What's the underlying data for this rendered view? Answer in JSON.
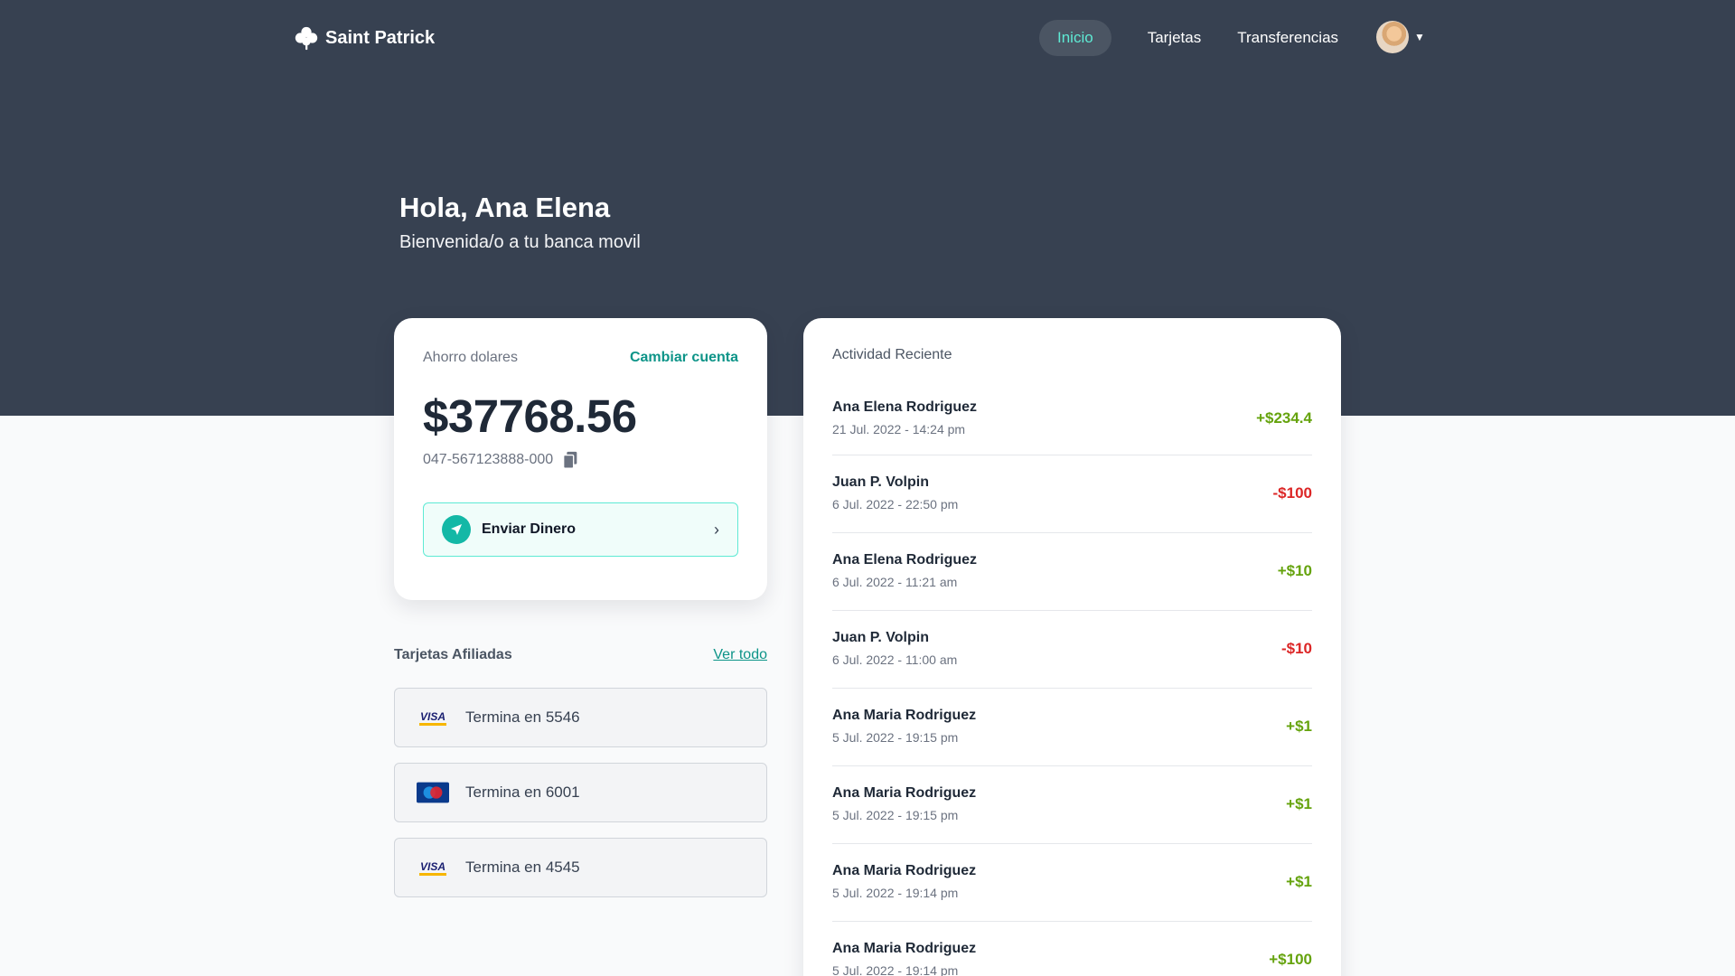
{
  "brand": {
    "name": "Saint Patrick",
    "accent": "#14b8a6",
    "nav_bg": "#374151"
  },
  "nav": {
    "items": [
      {
        "label": "Inicio",
        "active": true
      },
      {
        "label": "Tarjetas",
        "active": false
      },
      {
        "label": "Transferencias",
        "active": false
      }
    ]
  },
  "greeting": {
    "title": "Hola, Ana Elena",
    "subtitle": "Bienvenida/o a tu banca movil"
  },
  "account": {
    "type": "Ahorro dolares",
    "switch_label": "Cambiar cuenta",
    "balance": "$37768.56",
    "number": "047-567123888-000",
    "send_label": "Enviar Dinero"
  },
  "cards": {
    "title": "Tarjetas Afiliadas",
    "view_all": "Ver todo",
    "items": [
      {
        "brand": "visa-icon",
        "label": "Termina en 5546"
      },
      {
        "brand": "maestro-icon",
        "label": "Termina en 6001"
      },
      {
        "brand": "visa-icon",
        "label": "Termina en 4545"
      }
    ]
  },
  "activity": {
    "title": "Actividad Reciente",
    "items": [
      {
        "name": "Ana Elena Rodriguez",
        "date": "21 Jul. 2022 - 14:24 pm",
        "amount": "+$234.4"
      },
      {
        "name": "Juan P. Volpin",
        "date": "6 Jul. 2022 - 22:50 pm",
        "amount": "-$100"
      },
      {
        "name": "Ana Elena Rodriguez",
        "date": "6 Jul. 2022 - 11:21 am",
        "amount": "+$10"
      },
      {
        "name": "Juan P. Volpin",
        "date": "6 Jul. 2022 - 11:00 am",
        "amount": "-$10"
      },
      {
        "name": "Ana Maria Rodriguez",
        "date": "5 Jul. 2022 - 19:15 pm",
        "amount": "+$1"
      },
      {
        "name": "Ana Maria Rodriguez",
        "date": "5 Jul. 2022 - 19:15 pm",
        "amount": "+$1"
      },
      {
        "name": "Ana Maria Rodriguez",
        "date": "5 Jul. 2022 - 19:14 pm",
        "amount": "+$1"
      },
      {
        "name": "Ana Maria Rodriguez",
        "date": "5 Jul. 2022 - 19:14 pm",
        "amount": "+$100"
      }
    ]
  }
}
